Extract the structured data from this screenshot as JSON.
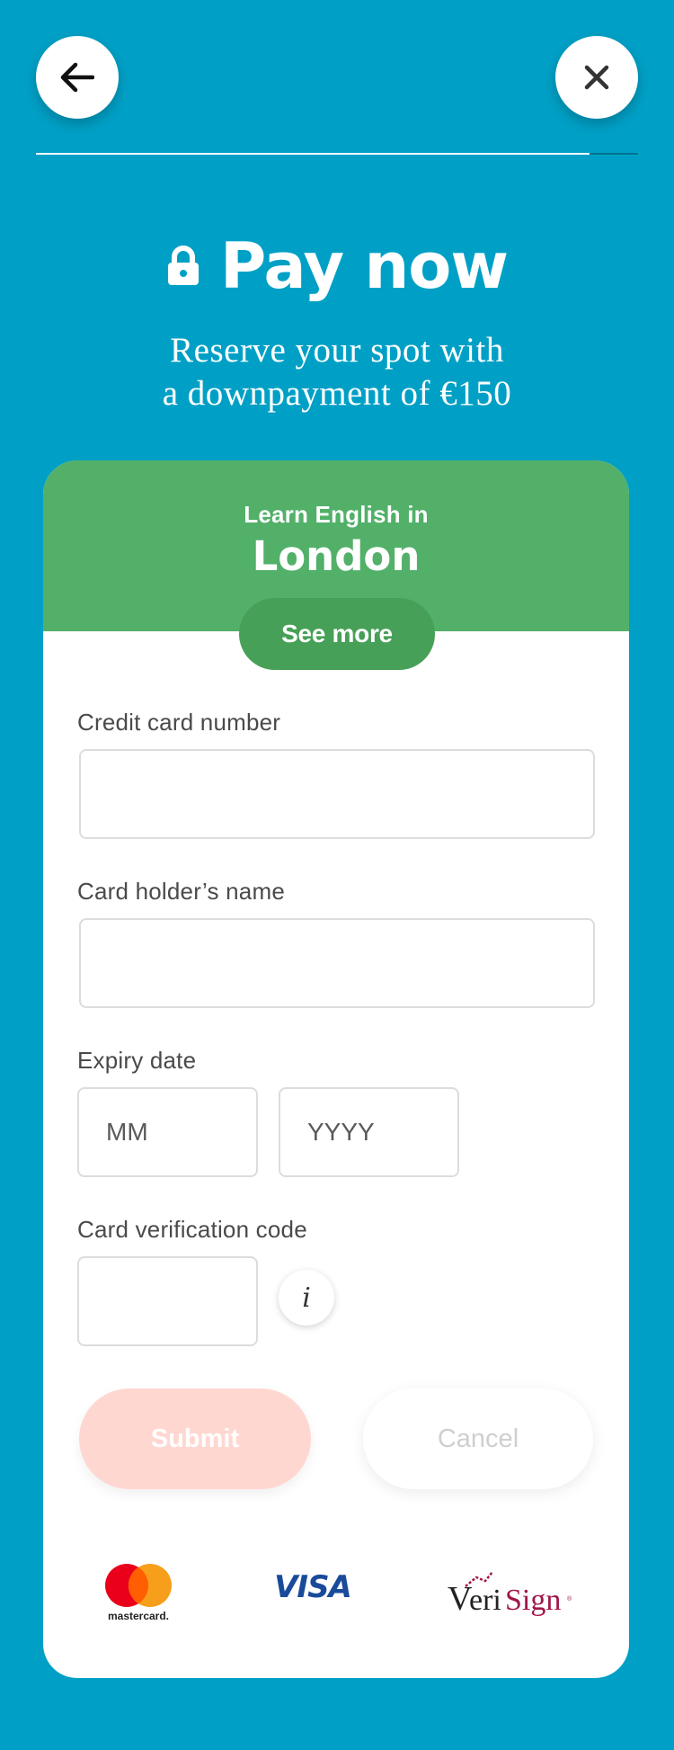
{
  "nav": {
    "back_icon": "arrow-left-icon",
    "close_icon": "close-icon",
    "progress_fraction": 0.92
  },
  "header": {
    "title": "Pay now",
    "lock_icon": "lock-icon",
    "subtitle_line1": "Reserve your spot with",
    "subtitle_line2": "a downpayment of  €150"
  },
  "course": {
    "intro": "Learn English in",
    "city": "London",
    "see_more_label": "See more",
    "header_color": "#52b069"
  },
  "form": {
    "card_number_label": "Credit card number",
    "card_number_value": "",
    "holder_name_label": "Card holder’s name",
    "holder_name_value": "",
    "expiry_label": "Expiry date",
    "expiry_month_placeholder": "MM",
    "expiry_year_placeholder": "YYYY",
    "cvc_label": "Card verification code",
    "cvc_value": "",
    "info_icon": "info-icon"
  },
  "actions": {
    "submit_label": "Submit",
    "cancel_label": "Cancel"
  },
  "payment_logos": {
    "mastercard": "mastercard",
    "visa": "VISA",
    "verisign": "VeriSign"
  },
  "colors": {
    "background": "#00a0c6",
    "accent_green": "#52b069",
    "submit_disabled": "#ffd7d1"
  }
}
